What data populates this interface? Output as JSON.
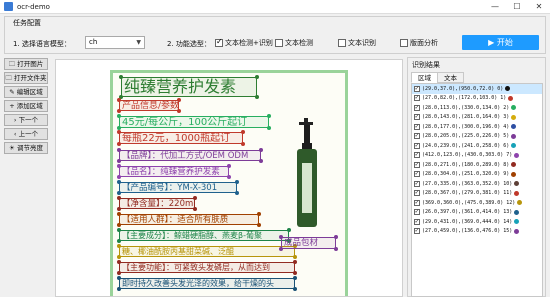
{
  "window": {
    "title": "ocr-demo",
    "controls": [
      "—",
      "☐",
      "✕"
    ]
  },
  "config": {
    "group_title": "任务配置",
    "model_label": "1. 选择语言模型：",
    "model_value": "ch",
    "function_label": "2. 功能选型：",
    "options": [
      {
        "label": "文本检测+识别",
        "checked": true
      },
      {
        "label": "文本检测",
        "checked": false
      },
      {
        "label": "文本识别",
        "checked": false
      },
      {
        "label": "版面分析",
        "checked": false
      }
    ],
    "start_label": "开始",
    "start_icon": "play-icon",
    "accent": "#1e9bff"
  },
  "toolbar": {
    "items": [
      "打开图片",
      "打开文件夹",
      "编辑区域",
      "添加区域",
      "下一个",
      "上一个",
      "调节亮度"
    ]
  },
  "document": {
    "border_color": "#9ad39a",
    "regions": [
      {
        "text": "纯臻营养护发素",
        "color": "#2e7d32"
      },
      {
        "text": "产品信息/参数",
        "color": "#c0392b"
      },
      {
        "text": "45元/每公斤，100公斤起订",
        "color": "#27ae60"
      },
      {
        "text": "每瓶22元，1000瓶起订",
        "color": "#c0392b"
      },
      {
        "text": "【品牌】：代加工方式/OEM ODM",
        "color": "#7d3c98"
      },
      {
        "text": "【品名】：纯臻营养护发素",
        "color": "#8e44ad"
      },
      {
        "text": "【产品编号】：YM-X-301",
        "color": "#1f618d"
      },
      {
        "text": "【净含量】：220ml",
        "color": "#922b21"
      },
      {
        "text": "【适用人群】：适合所有肤质",
        "color": "#a04000"
      },
      {
        "text": "【主要成分】：鲸蜡硬脂醇、燕麦β-葡聚",
        "color": "#1e8449"
      },
      {
        "text": "糖、椰油酰胺丙基甜菜碱、泛醌",
        "color": "#b7950b"
      },
      {
        "text": "【主要功能】：可紧致头发磷层，从而达到",
        "color": "#922b21"
      },
      {
        "text": "即时持久改善头发光泽的效果，给干燥的头",
        "color": "#1a5276"
      },
      {
        "text": "成品包材",
        "color": "#7d3c98"
      }
    ]
  },
  "results": {
    "title": "识别结果",
    "tabs": [
      "区域",
      "文本"
    ],
    "rows": [
      {
        "text": "(29.0,37.0),(950.0,72.0) 0)",
        "dot": "#111111"
      },
      {
        "text": "(27.0,82.0),(172.0,103.0) 1)",
        "dot": "#c0392b"
      },
      {
        "text": "(28.0,113.0),(330.0,134.0) 2)",
        "dot": "#27ae60"
      },
      {
        "text": "(28.0,143.0),(281.0,164.0) 3)",
        "dot": "#d4ac0d"
      },
      {
        "text": "(28.0,177.0),(300.0,196.0) 4)",
        "dot": "#2e4fa3"
      },
      {
        "text": "(28.0,205.0),(225.0,226.0) 5)",
        "dot": "#7d3c98"
      },
      {
        "text": "(24.0,239.0),(241.0,258.0) 6)",
        "dot": "#17a2b8"
      },
      {
        "text": "(412.0,123.0),(430.0,303.0) 7)",
        "dot": "#8e44ad"
      },
      {
        "text": "(28.0,271.0),(180.0,289.0) 8)",
        "dot": "#922b21"
      },
      {
        "text": "(28.0,304.0),(251.0,320.0) 9)",
        "dot": "#a04000"
      },
      {
        "text": "(27.0,335.0),(363.0,352.0) 10)",
        "dot": "#5d4037"
      },
      {
        "text": "(28.0,367.0),(279.0,381.0) 11)",
        "dot": "#c0392b"
      },
      {
        "text": "(369.0,360.0),(475.0,389.0) 12)",
        "dot": "#b7950b"
      },
      {
        "text": "(26.0,397.0),(361.0,414.0) 13)",
        "dot": "#1f618d"
      },
      {
        "text": "(29.0,431.0),(369.0,444.0) 14)",
        "dot": "#17a2b8"
      },
      {
        "text": "(27.0,459.0),(136.0,476.0) 15)",
        "dot": "#7d3c98"
      }
    ]
  }
}
